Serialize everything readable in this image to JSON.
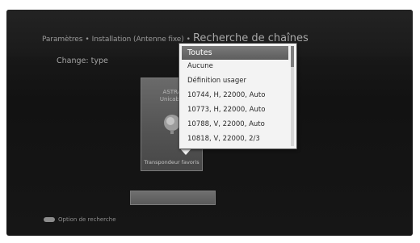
{
  "header": {
    "crumb_1": "Paramètres",
    "sep_1": "•",
    "crumb_2": "Installation (Antenne fixe)",
    "sep_2": "•",
    "title": "Recherche de chaînes"
  },
  "main": {
    "change_type_label": "Change: type",
    "tile": {
      "satellite_label": "ASTRA Unicable",
      "caption": "Transpondeur favoris",
      "icon": "satellite-dish-icon"
    },
    "footer": {
      "key_color": "#8c8c8c",
      "label": "Option de recherche"
    }
  },
  "dropdown": {
    "items": [
      {
        "label": "Toutes",
        "selected": true
      },
      {
        "label": "Aucune",
        "selected": false
      },
      {
        "label": "Définition usager",
        "selected": false
      },
      {
        "label": "10744, H, 22000, Auto",
        "selected": false
      },
      {
        "label": "10773, H, 22000, Auto",
        "selected": false
      },
      {
        "label": "10788, V, 22000, Auto",
        "selected": false
      },
      {
        "label": "10818, V, 22000, 2/3",
        "selected": false
      }
    ]
  },
  "colors": {
    "background": "#161616",
    "highlight": "#6a6a6a",
    "menu": "#f3f3f3"
  }
}
